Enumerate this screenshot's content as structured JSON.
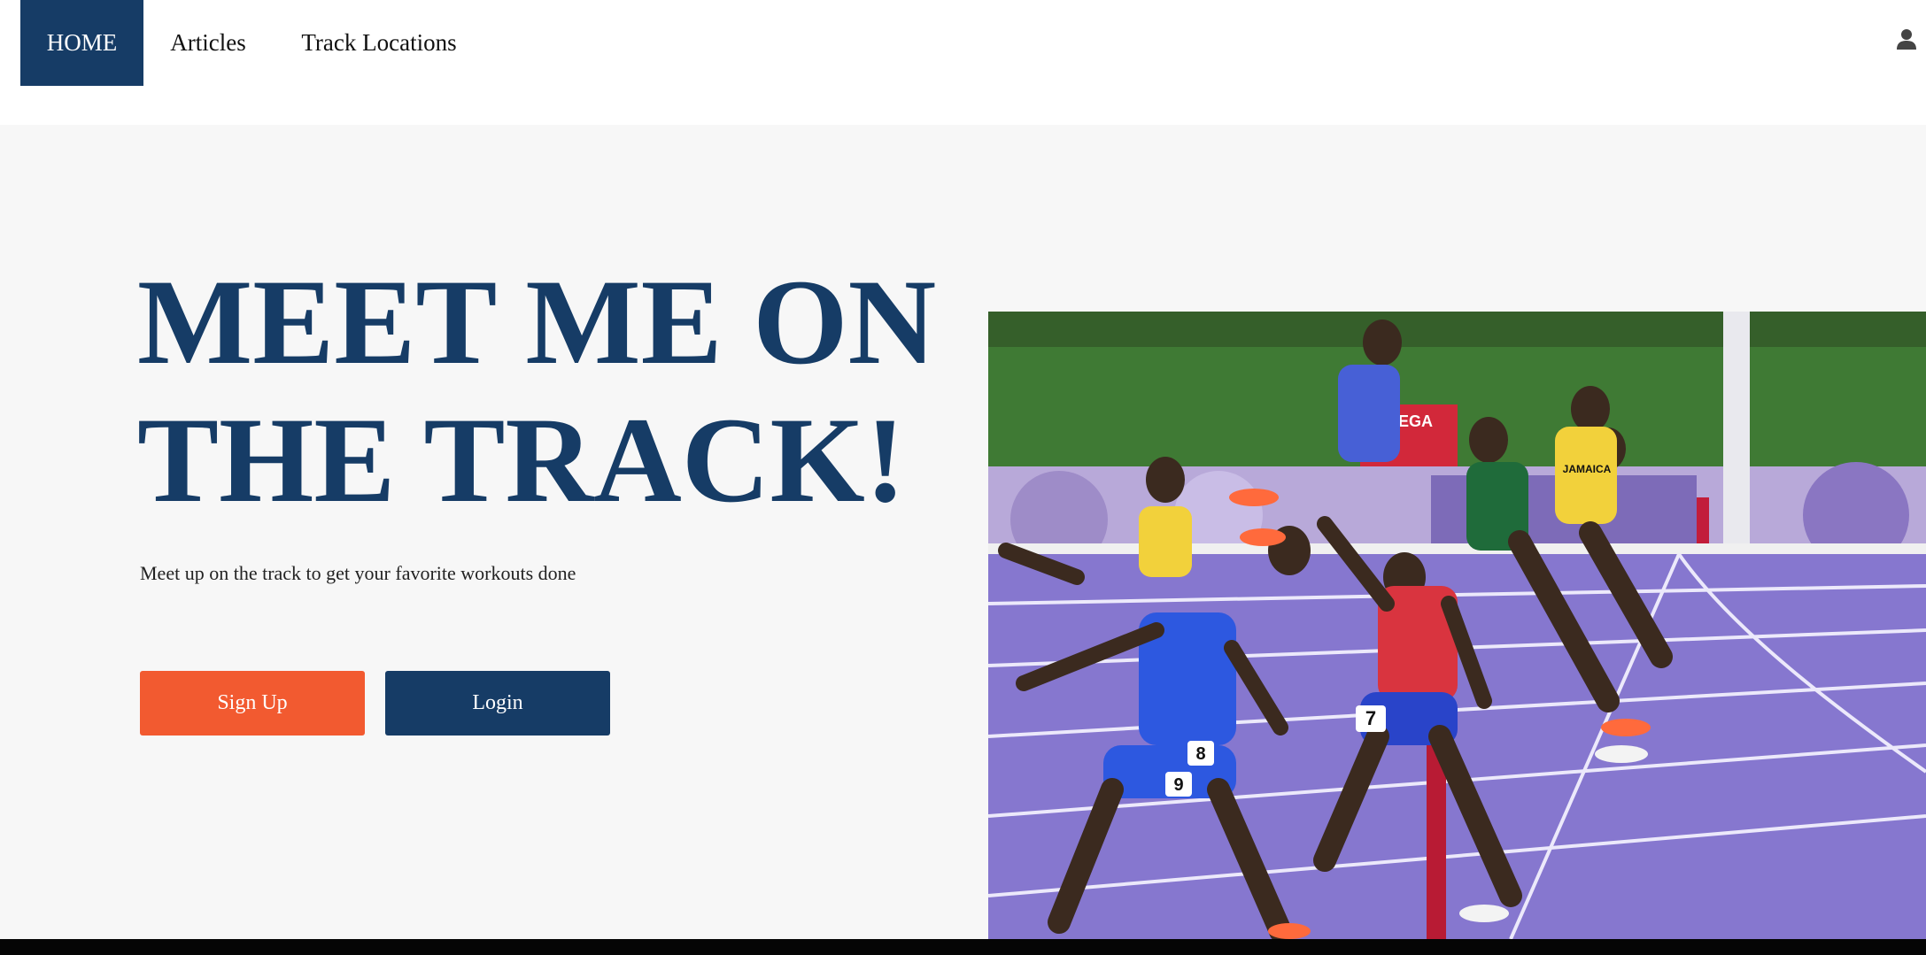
{
  "nav": {
    "items": [
      {
        "label": "HOME"
      },
      {
        "label": "Articles"
      },
      {
        "label": "Track Locations"
      }
    ],
    "user_icon": "user-icon"
  },
  "hero": {
    "headline_line1": "MEET ME ON",
    "headline_line2": "THE TRACK!",
    "subtext": "Meet up on the track to get your favorite workouts done",
    "signup_label": "Sign Up",
    "login_label": "Login",
    "image_alt": "Sprinters crossing the finish line on a purple track",
    "image_text": {
      "sponsor": "MEGA",
      "bib_1": "7",
      "bib_2": "8",
      "bib_3": "9",
      "jersey": "JAMAICA"
    }
  },
  "colors": {
    "brand_navy": "#163c66",
    "accent_orange": "#f25a30",
    "hero_bg": "#f7f7f7",
    "footer": "#050505"
  }
}
